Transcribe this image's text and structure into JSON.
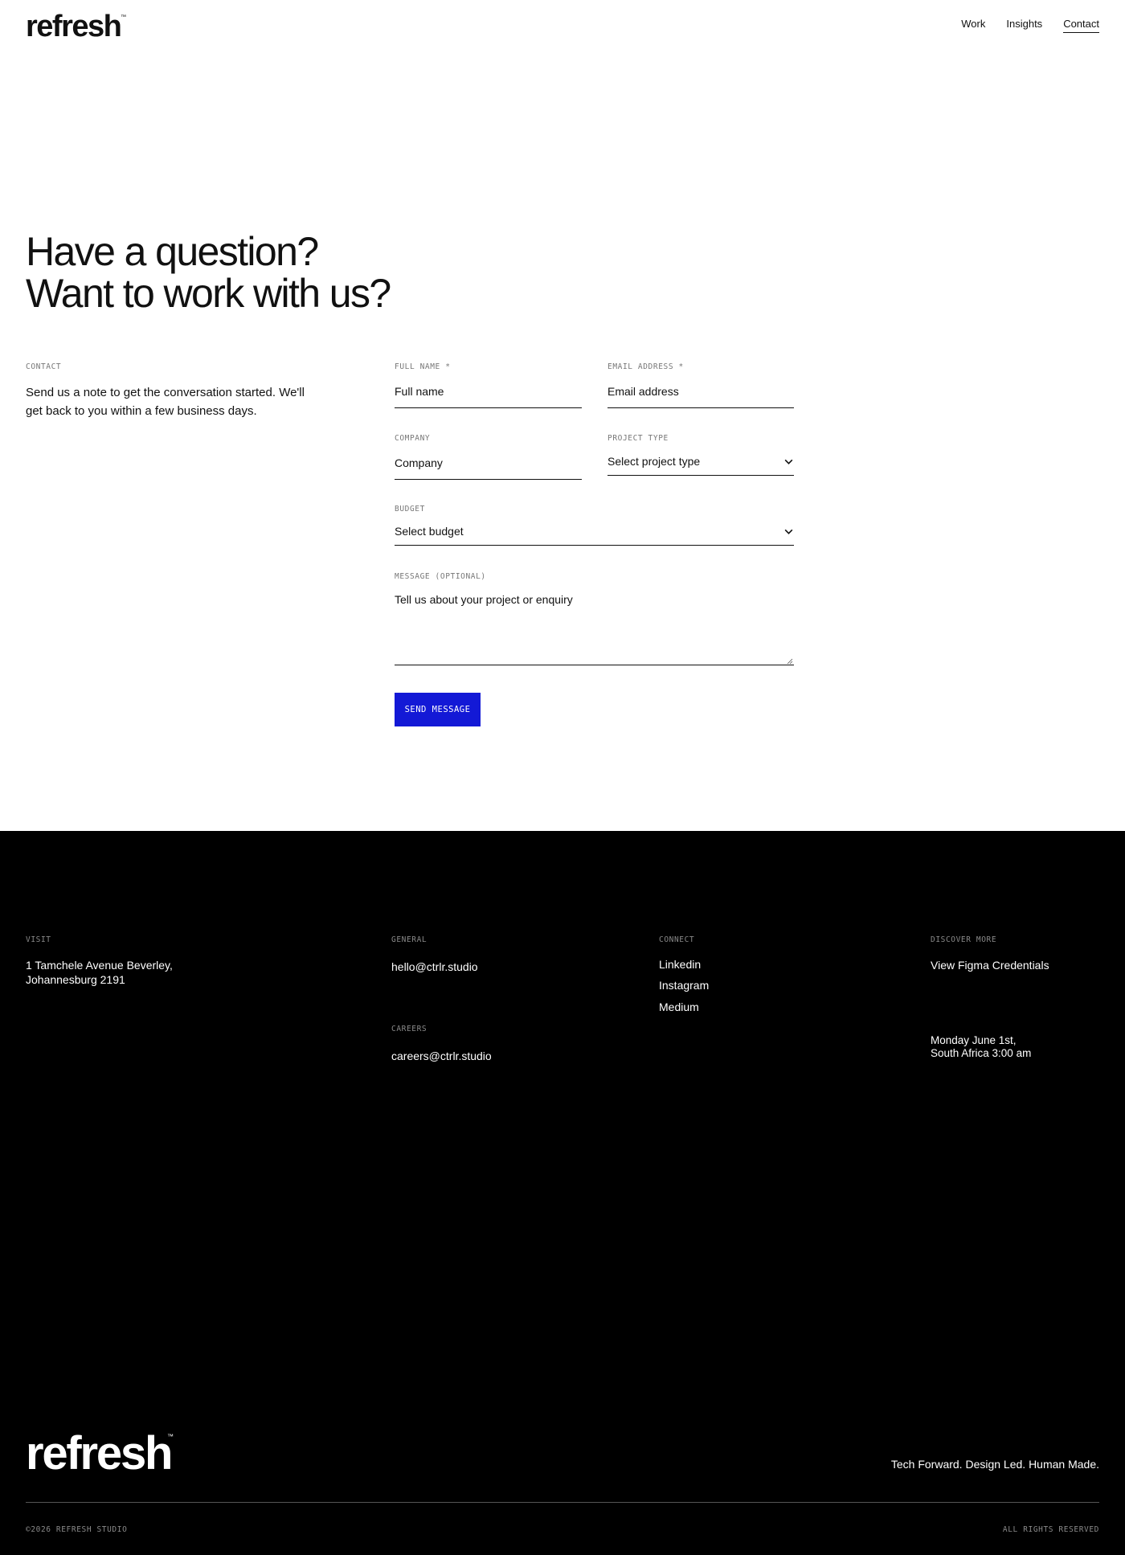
{
  "header": {
    "logo": "refresh",
    "logo_tm": "™",
    "nav": [
      "Work",
      "Insights",
      "Contact"
    ]
  },
  "hero": {
    "line1": "Have a question?",
    "line2": "Want to work with us?"
  },
  "intro": {
    "label": "CONTACT",
    "text": "Send us a note to get the conversation started. We'll get back to you within a few business days."
  },
  "form": {
    "full_name": {
      "label": "FULL NAME *",
      "placeholder": "Full name"
    },
    "email": {
      "label": "EMAIL ADDRESS *",
      "placeholder": "Email address"
    },
    "company": {
      "label": "COMPANY",
      "placeholder": "Company"
    },
    "project_type": {
      "label": "PROJECT TYPE",
      "value": "Select project type"
    },
    "budget": {
      "label": "BUDGET",
      "value": "Select budget"
    },
    "message": {
      "label": "MESSAGE (OPTIONAL)",
      "placeholder": "Tell us about your project or enquiry"
    },
    "submit_label": "SEND MESSAGE"
  },
  "colors": {
    "accent": "#1319d6",
    "footer_bg": "#000000",
    "text": "#111111"
  },
  "footer": {
    "visit": {
      "label": "VISIT",
      "line1": "1 Tamchele Avenue Beverley,",
      "line2": "Johannesburg 2191"
    },
    "general": {
      "label": "GENERAL",
      "email": "hello@ctrlr.studio"
    },
    "careers": {
      "label": "CAREERS",
      "email": "careers@ctrlr.studio"
    },
    "connect": {
      "label": "CONNECT",
      "links": [
        "Linkedin",
        "Instagram",
        "Medium"
      ]
    },
    "discover": {
      "label": "DISCOVER MORE",
      "link": "View Figma Credentials"
    },
    "datetime": {
      "line1": "Monday June 1st,",
      "line2": "South Africa 3:00 am"
    },
    "logo": "refresh",
    "logo_tm": "™",
    "tagline": "Tech Forward. Design Led. Human Made.",
    "copyright": "©2026 REFRESH STUDIO",
    "rights": "ALL RIGHTS RESERVED"
  }
}
